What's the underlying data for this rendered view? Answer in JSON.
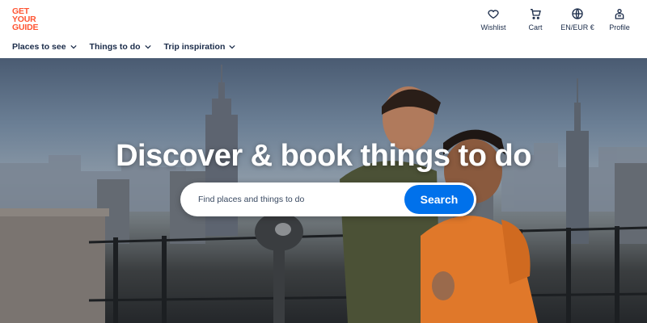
{
  "brand": {
    "logo_lines": [
      "GET",
      "YOUR",
      "GUIDE"
    ],
    "color": "#ff5533"
  },
  "top_actions": [
    {
      "label": "Wishlist",
      "icon": "heart-icon"
    },
    {
      "label": "Cart",
      "icon": "cart-icon"
    },
    {
      "label": "EN/EUR €",
      "icon": "globe-icon"
    },
    {
      "label": "Profile",
      "icon": "profile-icon"
    }
  ],
  "nav": [
    {
      "label": "Places to see"
    },
    {
      "label": "Things to do"
    },
    {
      "label": "Trip inspiration"
    }
  ],
  "hero": {
    "headline": "Discover & book things to do",
    "search_placeholder": "Find places and things to do",
    "search_button": "Search"
  },
  "colors": {
    "accent": "#0071eb",
    "text": "#1a2b49"
  }
}
